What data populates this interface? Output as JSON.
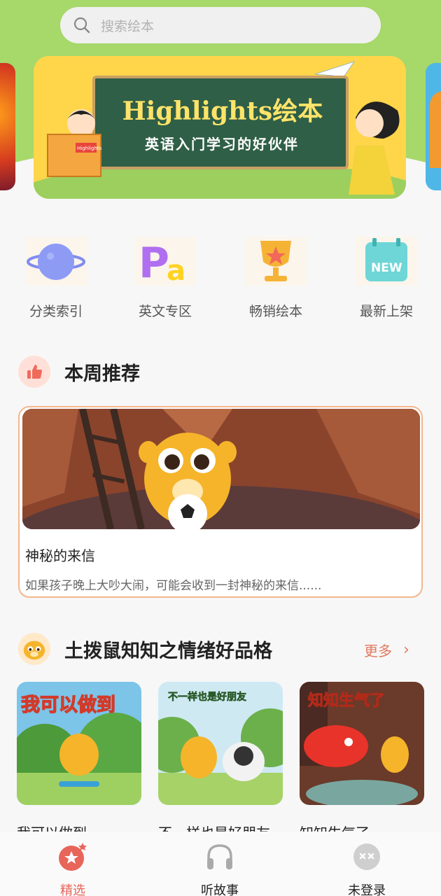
{
  "search": {
    "placeholder": "搜索绘本",
    "icon": "search-icon"
  },
  "banner": {
    "title": "Highlights绘本",
    "subtitle": "英语入门学习的好伙伴",
    "book_text": "Highlights"
  },
  "categories": [
    {
      "label": "分类索引",
      "icon": "planet-icon"
    },
    {
      "label": "英文专区",
      "icon": "letters-icon"
    },
    {
      "label": "畅销绘本",
      "icon": "trophy-icon"
    },
    {
      "label": "最新上架",
      "icon": "new-calendar-icon"
    }
  ],
  "weekly": {
    "title": "本周推荐",
    "icon": "thumbs-up-icon",
    "book": {
      "name": "神秘的来信",
      "desc": "如果孩子晚上大吵大闹，可能会收到一封神秘的来信......"
    }
  },
  "series": {
    "title": "土拨鼠知知之情绪好品格",
    "more": "更多",
    "books": [
      {
        "name": "我可以做到",
        "cover_text": "我可以做到"
      },
      {
        "name": "不一样也是好朋友",
        "cover_text": "不一样也是好朋友"
      },
      {
        "name": "知知生气了",
        "cover_text": "知知生气了"
      }
    ]
  },
  "tabs": [
    {
      "label": "精选",
      "icon": "star-icon",
      "active": true
    },
    {
      "label": "听故事",
      "icon": "headphones-icon",
      "active": false
    },
    {
      "label": "未登录",
      "icon": "user-avatar-icon",
      "active": false
    }
  ],
  "colors": {
    "accent": "#e07a5f",
    "top_bg": "#a6d86a",
    "banner_bg": "#ffd54a"
  }
}
